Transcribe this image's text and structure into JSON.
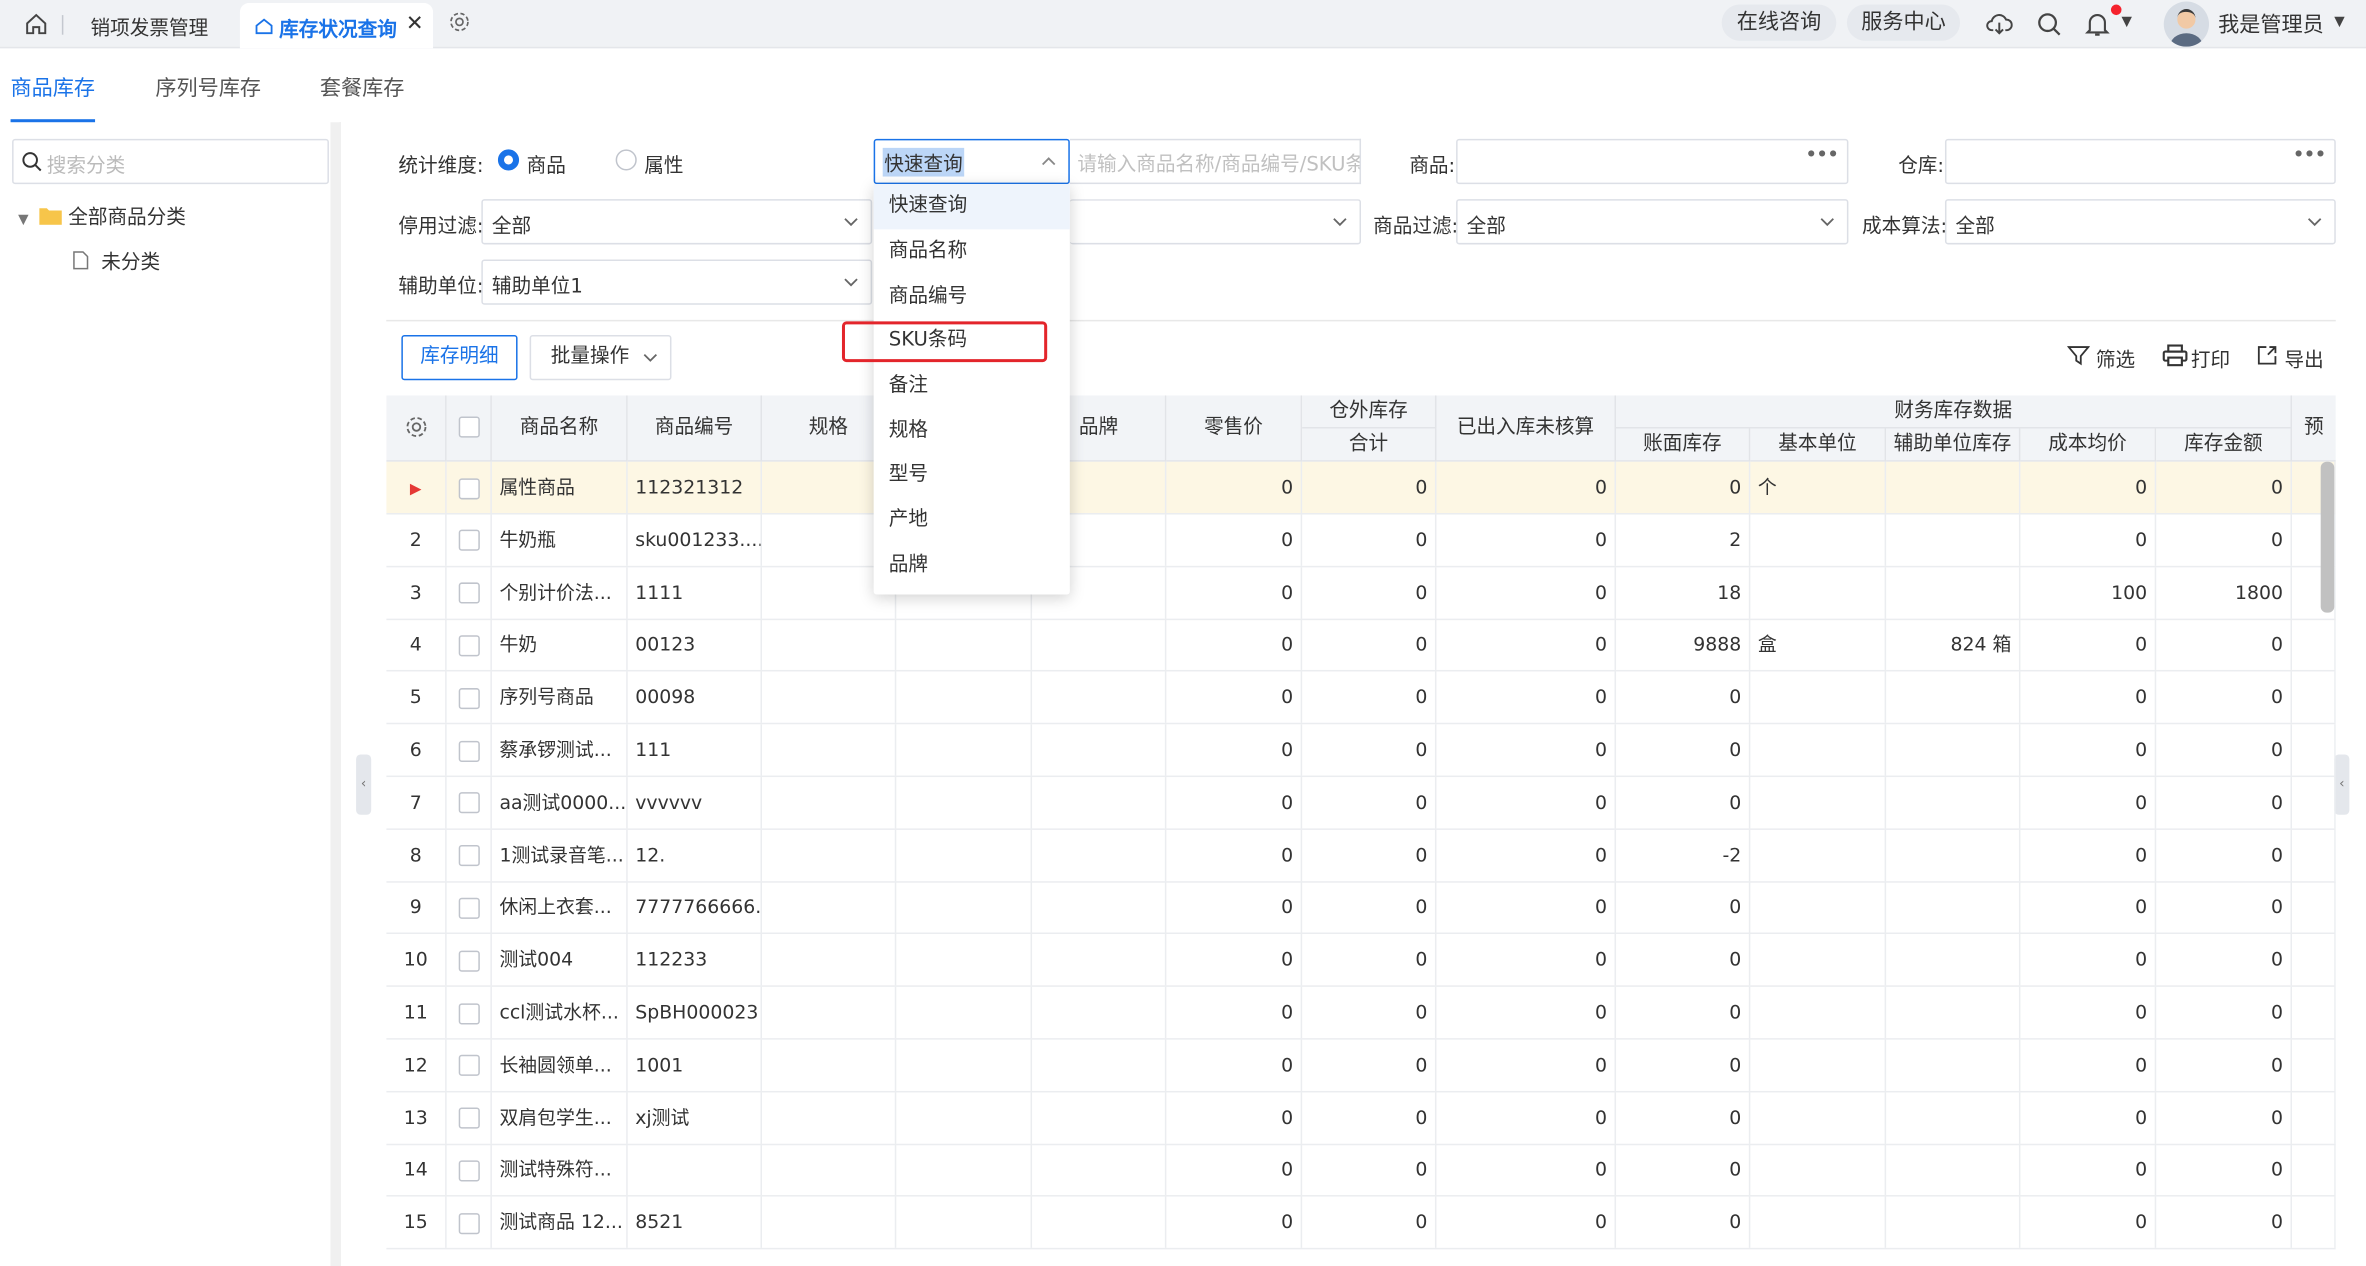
{
  "topbar": {
    "tabs": [
      {
        "label": "销项发票管理"
      },
      {
        "label": "库存状况查询"
      }
    ],
    "online_consult": "在线咨询",
    "service_center": "服务中心",
    "user_name": "我是管理员",
    "icons": [
      "home-icon",
      "gear-icon",
      "cloud-download-icon",
      "search-icon",
      "bell-icon"
    ]
  },
  "subtabs": [
    "商品库存",
    "序列号库存",
    "套餐库存"
  ],
  "sidebar": {
    "search_placeholder": "搜索分类",
    "tree_root": "全部商品分类",
    "tree_child": "未分类"
  },
  "filters": {
    "dimension_label": "统计维度:",
    "radio_goods": "商品",
    "radio_attr": "属性",
    "quick_query_value": "快速查询",
    "quick_query_placeholder": "请输入商品名称/商品编号/SKU条...",
    "goods_label": "商品:",
    "warehouse_label": "仓库:",
    "disable_filter_label": "停用过滤:",
    "disable_filter_value": "全部",
    "goods_filter_label": "商品过滤:",
    "goods_filter_value": "全部",
    "cost_method_label": "成本算法:",
    "cost_method_value": "全部",
    "aux_unit_label": "辅助单位:",
    "aux_unit_value": "辅助单位1"
  },
  "toolbar": {
    "detail": "库存明细",
    "batch": "批量操作",
    "filter": "筛选",
    "print": "打印",
    "export": "导出"
  },
  "dropdown": {
    "items": [
      "快速查询",
      "商品名称",
      "商品编号",
      "SKU条码",
      "备注",
      "规格",
      "型号",
      "产地",
      "品牌"
    ],
    "highlighted": "SKU条码"
  },
  "table": {
    "headers": {
      "name": "商品名称",
      "code": "商品编号",
      "spec": "规格",
      "brand": "品牌",
      "retail": "零售价",
      "outside_group": "仓外库存",
      "outside_total": "合计",
      "unchecked": "已出入库未核算",
      "finance_group": "财务库存数据",
      "book": "账面库存",
      "base_unit": "基本单位",
      "aux_stock": "辅助单位库存",
      "avg_cost": "成本均价",
      "amount": "库存金额",
      "pre": "预"
    },
    "rows": [
      {
        "no": "",
        "name": "属性商品",
        "code": "112321312",
        "retail": "0",
        "outside": "0",
        "unchecked": "0",
        "book": "0",
        "unit": "个",
        "aux": "",
        "avg": "0",
        "amount": "0"
      },
      {
        "no": "2",
        "name": "牛奶瓶",
        "code": "sku001233....",
        "retail": "0",
        "outside": "0",
        "unchecked": "0",
        "book": "2",
        "unit": "",
        "aux": "",
        "avg": "0",
        "amount": "0"
      },
      {
        "no": "3",
        "name": "个别计价法...",
        "code": "1111",
        "retail": "0",
        "outside": "0",
        "unchecked": "0",
        "book": "18",
        "unit": "",
        "aux": "",
        "avg": "100",
        "amount": "1800"
      },
      {
        "no": "4",
        "name": "牛奶",
        "code": "00123",
        "retail": "0",
        "outside": "0",
        "unchecked": "0",
        "book": "9888",
        "unit": "盒",
        "aux": "824 箱",
        "avg": "0",
        "amount": "0"
      },
      {
        "no": "5",
        "name": "序列号商品",
        "code": "00098",
        "retail": "0",
        "outside": "0",
        "unchecked": "0",
        "book": "0",
        "unit": "",
        "aux": "",
        "avg": "0",
        "amount": "0"
      },
      {
        "no": "6",
        "name": "蔡承锣测试...",
        "code": "111",
        "retail": "0",
        "outside": "0",
        "unchecked": "0",
        "book": "0",
        "unit": "",
        "aux": "",
        "avg": "0",
        "amount": "0"
      },
      {
        "no": "7",
        "name": "aa测试0000...",
        "code": "vvvvvv",
        "retail": "0",
        "outside": "0",
        "unchecked": "0",
        "book": "0",
        "unit": "",
        "aux": "",
        "avg": "0",
        "amount": "0"
      },
      {
        "no": "8",
        "name": "1测试录音笔...",
        "code": "12.",
        "retail": "0",
        "outside": "0",
        "unchecked": "0",
        "book": "-2",
        "unit": "",
        "aux": "",
        "avg": "0",
        "amount": "0"
      },
      {
        "no": "9",
        "name": "休闲上衣套...",
        "code": "7777766666...",
        "retail": "0",
        "outside": "0",
        "unchecked": "0",
        "book": "0",
        "unit": "",
        "aux": "",
        "avg": "0",
        "amount": "0"
      },
      {
        "no": "10",
        "name": "测试004",
        "code": "112233",
        "retail": "0",
        "outside": "0",
        "unchecked": "0",
        "book": "0",
        "unit": "",
        "aux": "",
        "avg": "0",
        "amount": "0"
      },
      {
        "no": "11",
        "name": "ccl测试水杯...",
        "code": "SpBH000023",
        "retail": "0",
        "outside": "0",
        "unchecked": "0",
        "book": "0",
        "unit": "",
        "aux": "",
        "avg": "0",
        "amount": "0"
      },
      {
        "no": "12",
        "name": "长袖圆领单...",
        "code": "1001",
        "retail": "0",
        "outside": "0",
        "unchecked": "0",
        "book": "0",
        "unit": "",
        "aux": "",
        "avg": "0",
        "amount": "0"
      },
      {
        "no": "13",
        "name": "双肩包学生...",
        "code": "xj测试",
        "retail": "0",
        "outside": "0",
        "unchecked": "0",
        "book": "0",
        "unit": "",
        "aux": "",
        "avg": "0",
        "amount": "0"
      },
      {
        "no": "14",
        "name": "测试特殊符...",
        "code": "",
        "retail": "0",
        "outside": "0",
        "unchecked": "0",
        "book": "0",
        "unit": "",
        "aux": "",
        "avg": "0",
        "amount": "0"
      },
      {
        "no": "15",
        "name": "测试商品 12...",
        "code": "8521",
        "retail": "0",
        "outside": "0",
        "unchecked": "0",
        "book": "0",
        "unit": "",
        "aux": "",
        "avg": "0",
        "amount": "0"
      }
    ]
  },
  "colors": {
    "accent": "#1a73e8",
    "highlight_box": "#e3252b",
    "selected_row": "#fdf7e4"
  }
}
